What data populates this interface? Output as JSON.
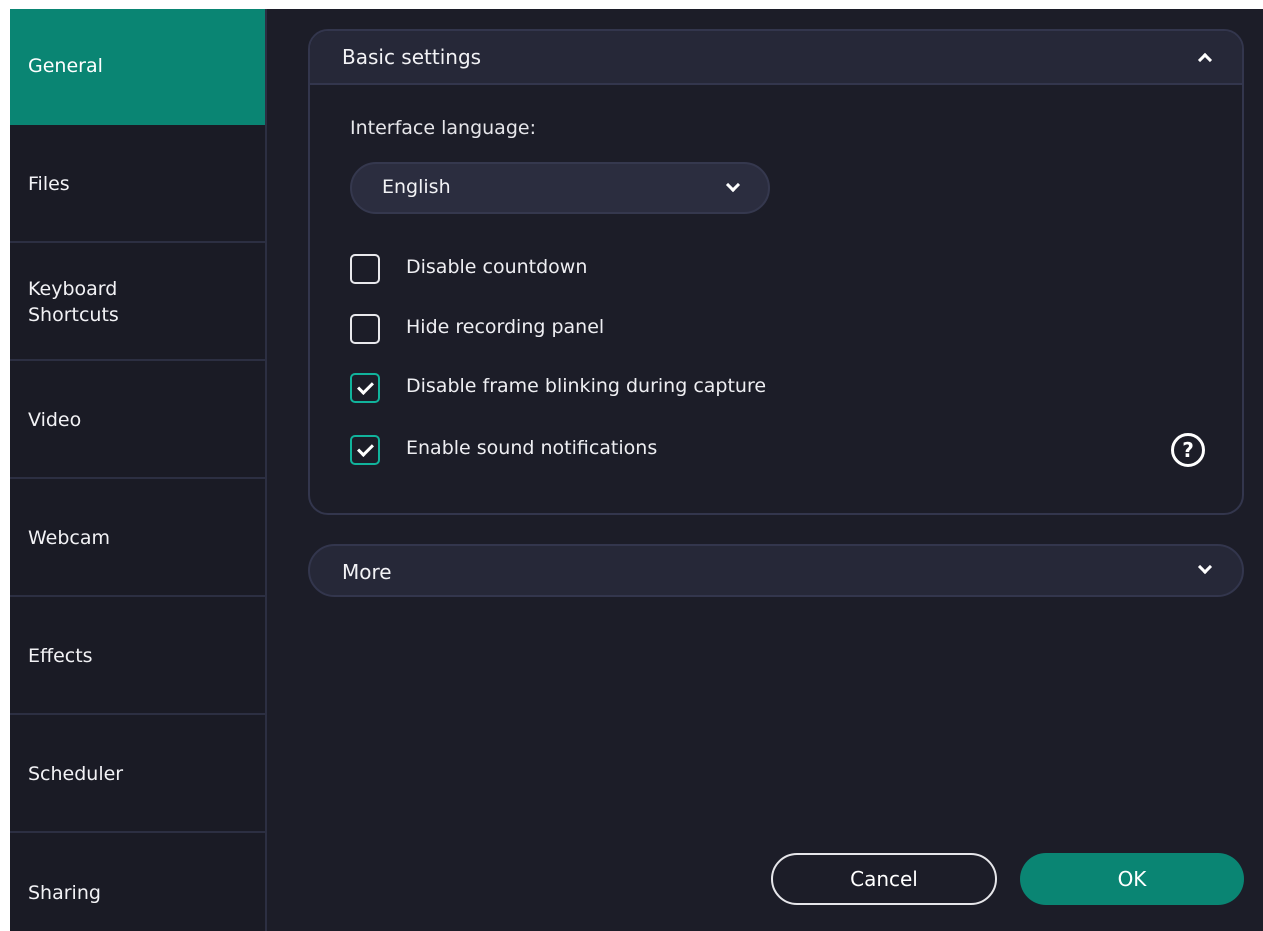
{
  "sidebar": {
    "items": [
      {
        "label": "General",
        "active": true
      },
      {
        "label": "Files",
        "active": false
      },
      {
        "label": "Keyboard\nShortcuts",
        "active": false
      },
      {
        "label": "Video",
        "active": false
      },
      {
        "label": "Webcam",
        "active": false
      },
      {
        "label": "Effects",
        "active": false
      },
      {
        "label": "Scheduler",
        "active": false
      },
      {
        "label": "Sharing",
        "active": false
      }
    ]
  },
  "basic_settings": {
    "title": "Basic settings",
    "expanded": true,
    "language_label": "Interface language:",
    "language_value": "English",
    "checkboxes": [
      {
        "label": "Disable countdown",
        "checked": false
      },
      {
        "label": "Hide recording panel",
        "checked": false
      },
      {
        "label": "Disable frame blinking during capture",
        "checked": true
      },
      {
        "label": "Enable sound notifications",
        "checked": true
      }
    ],
    "help_icon_text": "?"
  },
  "more": {
    "title": "More",
    "expanded": false
  },
  "buttons": {
    "cancel_label": "Cancel",
    "ok_label": "OK"
  },
  "colors": {
    "accent": "#0a8573",
    "checkbox_checked": "#11b39c",
    "background": "#1c1d28",
    "sidebar_background": "#1a1b25"
  },
  "icons": {
    "collapse": "chevron-up-icon",
    "expand": "chevron-down-icon",
    "dropdown": "chevron-down-icon",
    "help": "question-circle-icon",
    "check": "checkmark-icon"
  }
}
